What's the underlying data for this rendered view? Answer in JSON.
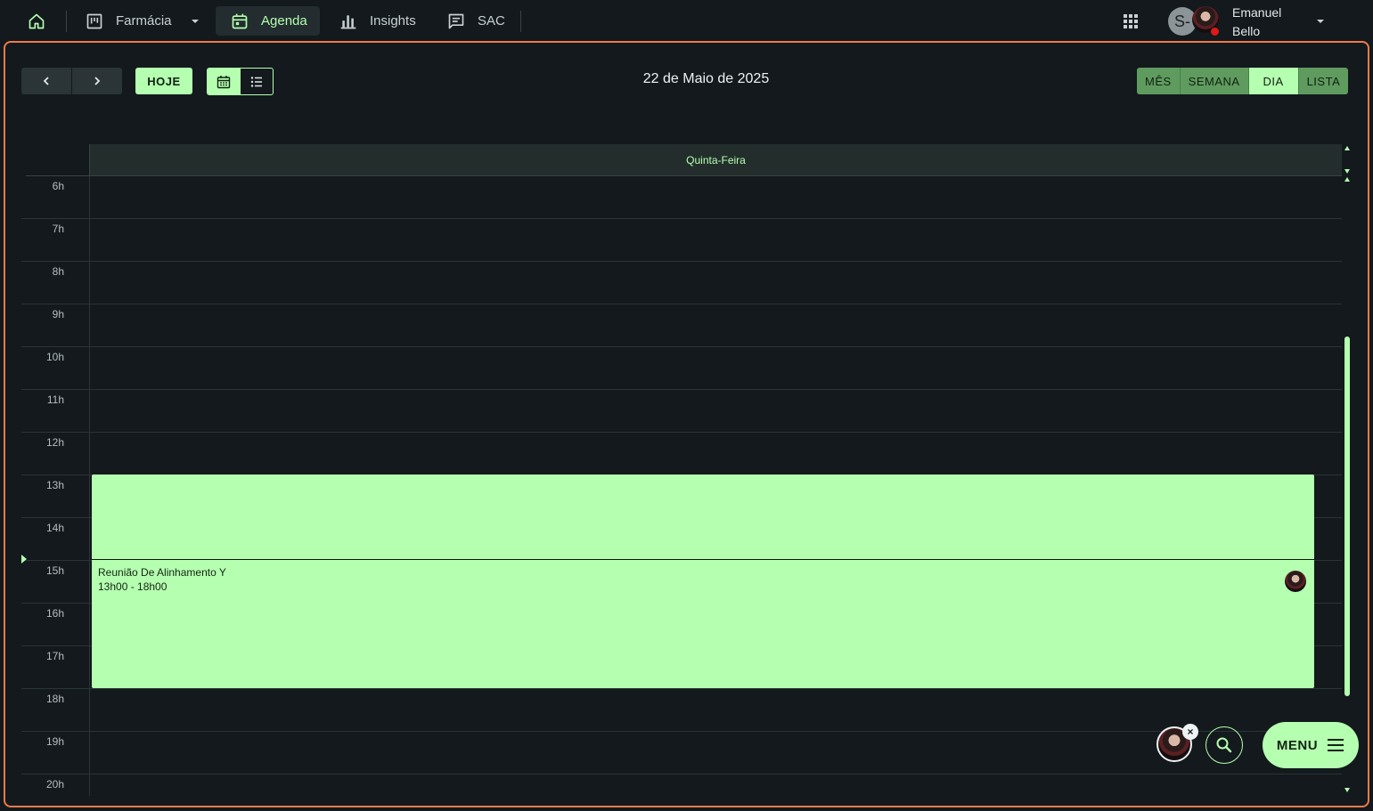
{
  "topbar": {
    "items": [
      {
        "name": "home",
        "label": "",
        "icon": "home-icon"
      },
      {
        "name": "farmacia",
        "label": "Farmácia",
        "icon": "board-icon"
      },
      {
        "name": "agenda",
        "label": "Agenda",
        "icon": "calendar-icon",
        "active": true
      },
      {
        "name": "insights",
        "label": "Insights",
        "icon": "bar-chart-icon"
      },
      {
        "name": "sac",
        "label": "SAC",
        "icon": "chat-icon"
      }
    ],
    "apps_icon": "grid-icon",
    "avatar_initial": "S-",
    "user_name": "Emanuel Bello",
    "status_color": "#e01818"
  },
  "toolbar": {
    "prev_icon": "chevron-left-icon",
    "next_icon": "chevron-right-icon",
    "today_label": "HOJE",
    "date_title": "22 de Maio de 2025",
    "views": [
      {
        "label": "MÊS",
        "active": false
      },
      {
        "label": "SEMANA",
        "active": false
      },
      {
        "label": "DIA",
        "active": true
      },
      {
        "label": "LISTA",
        "active": false
      }
    ]
  },
  "calendar": {
    "day_header": "Quinta-Feira",
    "hours": [
      "6h",
      "7h",
      "8h",
      "9h",
      "10h",
      "11h",
      "12h",
      "13h",
      "14h",
      "15h",
      "16h",
      "17h",
      "18h",
      "19h",
      "20h"
    ],
    "events": [
      {
        "title": "Reunião De Alinhamento Y",
        "time": "13h00 - 18h00"
      }
    ]
  },
  "fab": {
    "menu_label": "MENU",
    "close_glyph": "×"
  },
  "colors": {
    "accent": "#b5ffb0",
    "frame": "#f07a4a",
    "background": "#13191c"
  }
}
